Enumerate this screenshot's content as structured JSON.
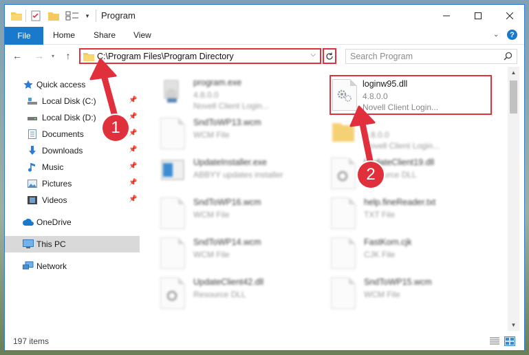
{
  "window": {
    "title": "Program"
  },
  "ribbon": {
    "file": "File",
    "home": "Home",
    "share": "Share",
    "view": "View",
    "help": "?"
  },
  "nav": {
    "address": "C:\\Program Files\\Program Directory",
    "search_placeholder": "Search Program"
  },
  "sidebar": {
    "items": [
      {
        "label": "Quick access",
        "icon": "star-icon"
      },
      {
        "label": "Local Disk (C:)",
        "icon": "drive-icon"
      },
      {
        "label": "Local Disk (D:)",
        "icon": "drive-icon"
      },
      {
        "label": "Documents",
        "icon": "documents-icon"
      },
      {
        "label": "Downloads",
        "icon": "download-icon"
      },
      {
        "label": "Music",
        "icon": "music-icon"
      },
      {
        "label": "Pictures",
        "icon": "pictures-icon"
      },
      {
        "label": "Videos",
        "icon": "videos-icon"
      },
      {
        "label": "OneDrive",
        "icon": "cloud-icon"
      },
      {
        "label": "This PC",
        "icon": "computer-icon"
      },
      {
        "label": "Network",
        "icon": "network-icon"
      }
    ]
  },
  "files": {
    "left": [
      {
        "name": "program.exe",
        "sub1": "4.8.0.0",
        "sub2": "Novell Client Login..."
      },
      {
        "name": "SndToWP13.wcm",
        "sub1": "WCM File",
        "sub2": ""
      },
      {
        "name": "UpdateInstaller.exe",
        "sub1": "ABBYY updates installer",
        "sub2": ""
      },
      {
        "name": "SndToWP16.wcm",
        "sub1": "WCM File",
        "sub2": ""
      },
      {
        "name": "SndToWP14.wcm",
        "sub1": "WCM File",
        "sub2": ""
      },
      {
        "name": "UpdateClient42.dll",
        "sub1": "Resource DLL",
        "sub2": ""
      }
    ],
    "right": [
      {
        "name": "loginw95.dll",
        "sub1": "4.8.0.0",
        "sub2": "Novell Client Login..."
      },
      {
        "name": "",
        "sub1": "4.8.0.0",
        "sub2": "Novell Client Login..."
      },
      {
        "name": "UpdateClient19.dll",
        "sub1": "Resource DLL",
        "sub2": ""
      },
      {
        "name": "help.fineReader.txt",
        "sub1": "TXT File",
        "sub2": ""
      },
      {
        "name": "FastKorn.cjk",
        "sub1": "CJK File",
        "sub2": ""
      },
      {
        "name": "SndToWP15.wcm",
        "sub1": "WCM File",
        "sub2": ""
      }
    ]
  },
  "status": {
    "items": "197 items"
  },
  "callouts": {
    "one": "1",
    "two": "2"
  },
  "colors": {
    "accent": "#1979ca",
    "highlight": "#e0303c"
  }
}
